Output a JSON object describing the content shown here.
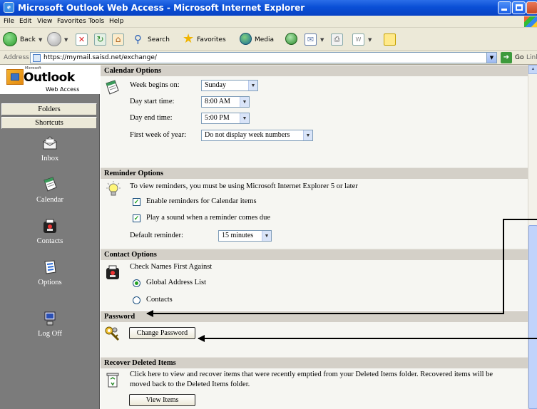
{
  "window": {
    "title": "Microsoft Outlook Web Access - Microsoft Internet Explorer",
    "icon": "ie-icon"
  },
  "menu": [
    "File",
    "Edit",
    "View",
    "Favorites",
    "Tools",
    "Help"
  ],
  "toolbar": {
    "back": "Back",
    "search": "Search",
    "favorites": "Favorites",
    "media": "Media"
  },
  "address": {
    "label": "Address",
    "url": "https://mymail.saisd.net/exchange/",
    "go": "Go",
    "links": "Links"
  },
  "logo": {
    "microsoft": "Microsoft",
    "outlook": "Outlook",
    "web_access": "Web Access"
  },
  "sidebar": {
    "folders": "Folders",
    "shortcuts": "Shortcuts",
    "items": [
      {
        "label": "Inbox",
        "icon": "inbox-icon"
      },
      {
        "label": "Calendar",
        "icon": "calendar-icon"
      },
      {
        "label": "Contacts",
        "icon": "contacts-icon"
      },
      {
        "label": "Options",
        "icon": "options-icon"
      },
      {
        "label": "Log Off",
        "icon": "logoff-icon"
      }
    ]
  },
  "calendar": {
    "heading": "Calendar Options",
    "week_begins_label": "Week begins on:",
    "week_begins_value": "Sunday",
    "day_start_label": "Day start time:",
    "day_start_value": "8:00 AM",
    "day_end_label": "Day end time:",
    "day_end_value": "5:00 PM",
    "first_week_label": "First week of year:",
    "first_week_value": "Do not display week numbers"
  },
  "reminder": {
    "heading": "Reminder Options",
    "note": "To view reminders, you must be using Microsoft Internet Explorer 5 or later",
    "enable_label": "Enable reminders for Calendar items",
    "enable_checked": true,
    "sound_label": "Play a sound when a reminder comes due",
    "sound_checked": true,
    "default_label": "Default reminder:",
    "default_value": "15 minutes"
  },
  "contact": {
    "heading": "Contact Options",
    "check_names_label": "Check Names First Against",
    "gal_label": "Global Address List",
    "contacts_label": "Contacts",
    "selected": "Global Address List"
  },
  "password": {
    "heading": "Password",
    "button": "Change Password"
  },
  "recover": {
    "heading": "Recover Deleted Items",
    "text_line1": "Click here to view and recover items that were recently emptied from your Deleted Items folder. Recovered items will be",
    "text_line2": "moved back to the Deleted Items folder.",
    "button": "View Items"
  },
  "colors": {
    "titlebar": "#0a4fd6",
    "sidebar": "#7b7b7b",
    "section_header": "#d4d0c8",
    "check_green": "#21a121"
  }
}
